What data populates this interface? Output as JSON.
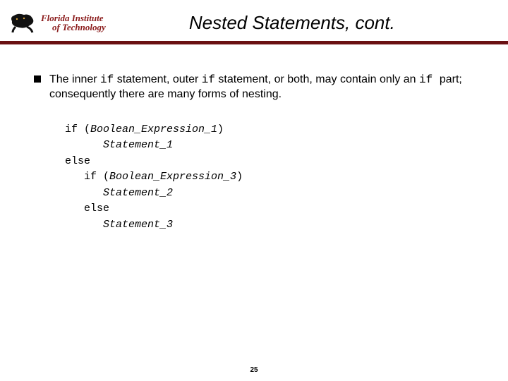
{
  "logo": {
    "line1": "Florida Institute",
    "line2": "of Technology"
  },
  "title": "Nested Statements, cont.",
  "bullet": {
    "seg1": "The inner ",
    "code1": "if",
    "seg2": " statement, outer ",
    "code2": "if",
    "seg3": " statement, or both, may contain only an ",
    "code3": " if ",
    "seg4": " part; consequently there are many forms of nesting."
  },
  "code": {
    "l1a": "if (",
    "l1b": "Boolean_Expression_1",
    "l1c": ")",
    "l2": "Statement_1",
    "l3": "else",
    "l4a": "if (",
    "l4b": "Boolean_Expression_3",
    "l4c": ")",
    "l5": "Statement_2",
    "l6": "else",
    "l7": "Statement_3"
  },
  "page_number": "25"
}
